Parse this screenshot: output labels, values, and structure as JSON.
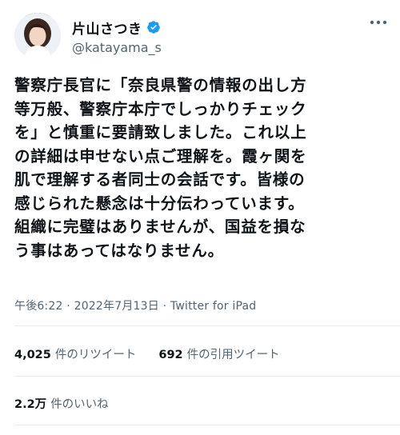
{
  "author": {
    "display_name": "片山さつき",
    "handle": "@katayama_s",
    "verified_color": "#1d9bf0"
  },
  "tweet": {
    "text": "警察庁長官に「奈良県警の情報の出し方\n等万般、警察庁本庁でしっかりチェック\nを」と慎重に要請致しました。これ以上\nの詳細は申せない点ご理解を。霞ヶ関を\n肌で理解する者同士の会話です。皆様の\n感じられた懸念は十分伝わっています。\n組織に完璧はありませんが、国益を損な\nう事はあってはなりません。",
    "time": "午後6:22",
    "separator": " · ",
    "date": "2022年7月13日",
    "source": "Twitter for iPad"
  },
  "stats": {
    "retweets_count": "4,025",
    "retweets_label": "件のリツイート",
    "quotes_count": "692",
    "quotes_label": "件の引用ツイート",
    "likes_count": "2.2万",
    "likes_label": "件のいいね"
  },
  "icons": {
    "verified": "verified-badge-icon",
    "more": "more-icon"
  }
}
